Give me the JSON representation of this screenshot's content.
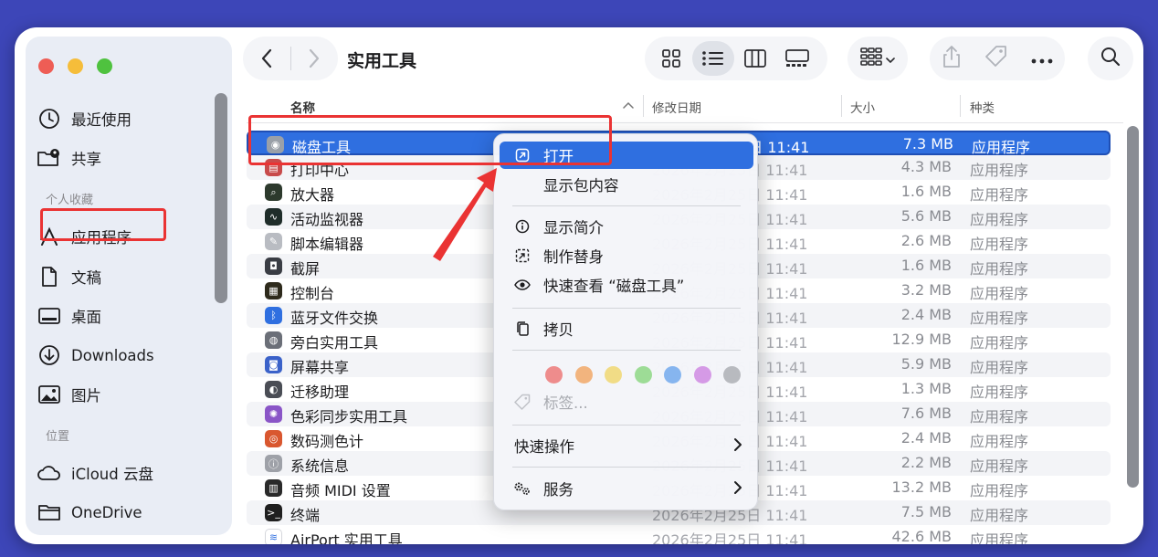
{
  "window": {
    "title": "实用工具"
  },
  "sidebar": {
    "recents": "最近使用",
    "shared": "共享",
    "favorites_header": "个人收藏",
    "favorites": [
      "应用程序",
      "文稿",
      "桌面",
      "Downloads",
      "图片"
    ],
    "locations_header": "位置",
    "locations": [
      "iCloud 云盘",
      "OneDrive"
    ]
  },
  "columns": {
    "name": "名称",
    "date": "修改日期",
    "size": "大小",
    "kind": "种类"
  },
  "files": [
    {
      "name": "磁盘工具",
      "date": "2026年2月25日 11:41",
      "size": "7.3 MB",
      "kind": "应用程序",
      "icon": "disk-utility-icon",
      "color": "#9aa0a8",
      "glyph": "◉"
    },
    {
      "name": "打印中心",
      "date": "2026年2月25日 11:41",
      "size": "4.3 MB",
      "kind": "应用程序",
      "icon": "printer-icon",
      "color": "#c84b4b",
      "glyph": "▤"
    },
    {
      "name": "放大器",
      "date": "2026年2月25日 11:41",
      "size": "1.6 MB",
      "kind": "应用程序",
      "icon": "magnifier-icon",
      "color": "#2d3a2d",
      "glyph": "⌕"
    },
    {
      "name": "活动监视器",
      "date": "2026年2月25日 11:41",
      "size": "5.6 MB",
      "kind": "应用程序",
      "icon": "activity-monitor-icon",
      "color": "#1f2d2a",
      "glyph": "∿"
    },
    {
      "name": "脚本编辑器",
      "date": "2026年2月25日 11:41",
      "size": "2.6 MB",
      "kind": "应用程序",
      "icon": "script-editor-icon",
      "color": "#b9bcc2",
      "glyph": "✎"
    },
    {
      "name": "截屏",
      "date": "2026年2月25日 11:41",
      "size": "1.6 MB",
      "kind": "应用程序",
      "icon": "screenshot-icon",
      "color": "#3a3d44",
      "glyph": "◘"
    },
    {
      "name": "控制台",
      "date": "2026年2月25日 11:41",
      "size": "3.2 MB",
      "kind": "应用程序",
      "icon": "console-icon",
      "color": "#2e2a1c",
      "glyph": "▦"
    },
    {
      "name": "蓝牙文件交换",
      "date": "2026年2月25日 11:41",
      "size": "2.4 MB",
      "kind": "应用程序",
      "icon": "bluetooth-icon",
      "color": "#2f6fe0",
      "glyph": "ᛒ"
    },
    {
      "name": "旁白实用工具",
      "date": "2026年2月25日 11:41",
      "size": "12.9 MB",
      "kind": "应用程序",
      "icon": "voiceover-icon",
      "color": "#6b6f78",
      "glyph": "◍"
    },
    {
      "name": "屏幕共享",
      "date": "2026年2月25日 11:41",
      "size": "5.9 MB",
      "kind": "应用程序",
      "icon": "screen-sharing-icon",
      "color": "#3b62c9",
      "glyph": "◙"
    },
    {
      "name": "迁移助理",
      "date": "2026年2月25日 11:41",
      "size": "1.3 MB",
      "kind": "应用程序",
      "icon": "migration-assistant-icon",
      "color": "#4a4d55",
      "glyph": "◐"
    },
    {
      "name": "色彩同步实用工具",
      "date": "2026年2月25日 11:41",
      "size": "7.6 MB",
      "kind": "应用程序",
      "icon": "colorsync-icon",
      "color": "#8a55c7",
      "glyph": "✺"
    },
    {
      "name": "数码测色计",
      "date": "2026年2月25日 11:41",
      "size": "2.4 MB",
      "kind": "应用程序",
      "icon": "color-meter-icon",
      "color": "#d9572f",
      "glyph": "◎"
    },
    {
      "name": "系统信息",
      "date": "2026年2月25日 11:41",
      "size": "2.2 MB",
      "kind": "应用程序",
      "icon": "system-info-icon",
      "color": "#9ea1a8",
      "glyph": "ⓘ"
    },
    {
      "name": "音频 MIDI 设置",
      "date": "2026年2月25日 11:41",
      "size": "13.2 MB",
      "kind": "应用程序",
      "icon": "audio-midi-icon",
      "color": "#2a2a2a",
      "glyph": "▥"
    },
    {
      "name": "终端",
      "date": "2026年2月25日 11:41",
      "size": "7.5 MB",
      "kind": "应用程序",
      "icon": "terminal-icon",
      "color": "#1f1f1f",
      "glyph": ">_"
    },
    {
      "name": "AirPort 实用工具",
      "date": "2026年2月25日 11:41",
      "size": "42.6 MB",
      "kind": "应用程序",
      "icon": "wifi-icon",
      "color": "#ffffff",
      "glyph": "≋"
    }
  ],
  "context_menu": {
    "open": "打开",
    "show_package": "显示包内容",
    "get_info": "显示简介",
    "make_alias": "制作替身",
    "quick_look": "快速查看 “磁盘工具”",
    "copy": "拷贝",
    "tag_colors": [
      "#ee8c8c",
      "#f2b47e",
      "#f1dc86",
      "#9ddc96",
      "#86b5ef",
      "#d59ae6",
      "#b8babf"
    ],
    "tags": "标签...",
    "quick_actions": "快速操作",
    "services": "服务"
  }
}
